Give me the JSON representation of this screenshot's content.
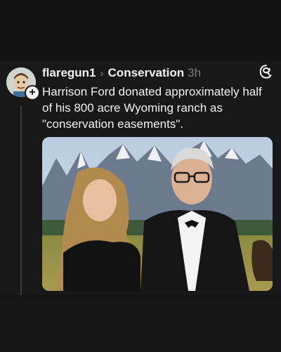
{
  "post": {
    "username": "flaregun1",
    "topic": "Conservation",
    "time": "3h",
    "text": "Harrison Ford donated approximately half of his 800 acre Wyoming ranch as \"conservation easements\"."
  },
  "icons": {
    "chevron": "›",
    "follow": "+",
    "threads": "threads-logo-icon"
  }
}
